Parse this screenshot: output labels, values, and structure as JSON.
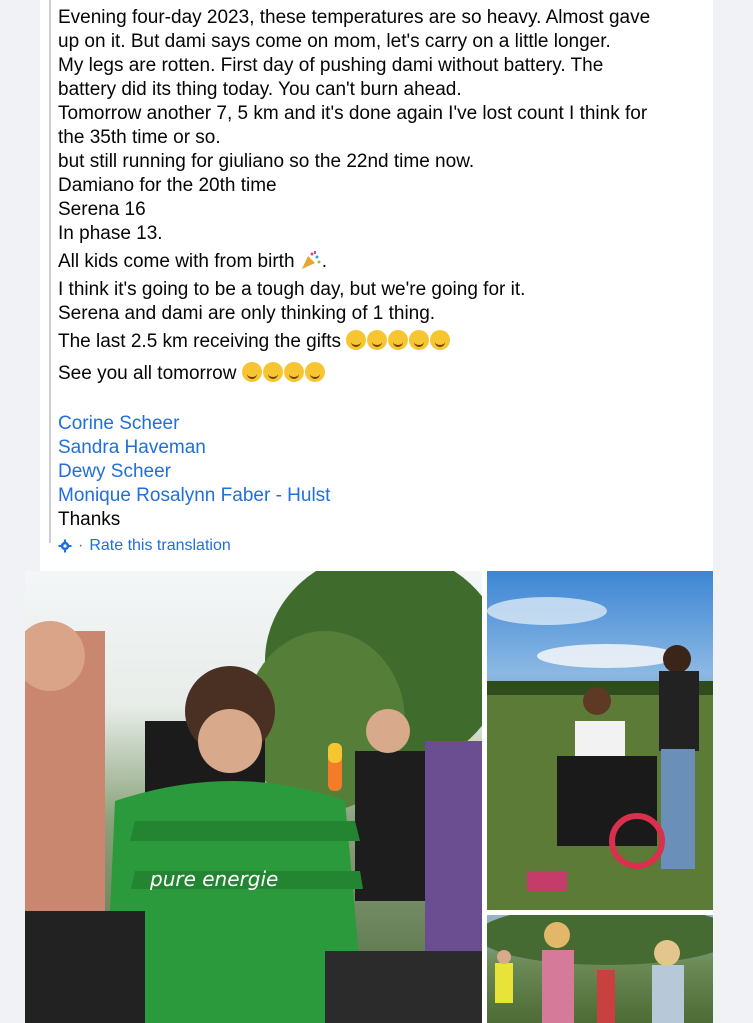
{
  "post": {
    "lines": [
      "Evening four-day 2023, these temperatures are so heavy. Almost gave",
      "up on it. But dami says come on mom, let's carry on a little longer.",
      "My legs are rotten. First day of pushing dami without battery. The",
      "battery did its thing today. You can't burn ahead.",
      "Tomorrow another 7, 5 km and it's done again I've lost count I think for",
      "the 35th time or so.",
      "but still running for giuliano so the 22nd time now.",
      "Damiano for the 20th time",
      "Serena 16",
      "In phase 13."
    ],
    "kids_line": "All kids come with from birth",
    "kids_line_end": ".",
    "tough_line": "I think it's going to be a tough day, but we're going for it.",
    "thinking_line": "Serena and dami are only thinking of 1 thing.",
    "gifts_line": "The last 2.5 km receiving the gifts",
    "see_line": "See you all tomorrow",
    "mentions": [
      "Corine Scheer",
      "Sandra Haveman",
      "Dewy Scheer",
      "Monique Rosalynn Faber - Hulst"
    ],
    "thanks": "Thanks"
  },
  "translation": {
    "separator": "·",
    "rate_label": "Rate this translation",
    "icon": "gear-icon"
  },
  "photos": {
    "main": {
      "jersey_brand": "pure energie"
    }
  },
  "colors": {
    "link": "#216fdb",
    "text": "#050505",
    "background": "#f0f2f5"
  }
}
